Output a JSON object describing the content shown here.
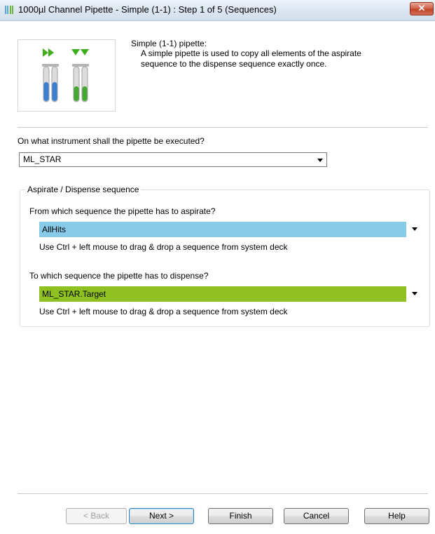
{
  "window": {
    "title": "1000µl Channel Pipette - Simple (1-1) : Step 1 of 5 (Sequences)",
    "close_label": "✕"
  },
  "description": {
    "title": "Simple (1-1) pipette:",
    "text": "A simple pipette is used to copy all elements of the aspirate sequence to the dispense sequence exactly once."
  },
  "instrument": {
    "question": "On what instrument shall the pipette be executed?",
    "selected": "ML_STAR"
  },
  "sequences": {
    "group_title": "Aspirate / Dispense sequence",
    "aspirate": {
      "question": "From which sequence the pipette has to aspirate?",
      "value": "AllHits",
      "hint": "Use Ctrl + left mouse to drag & drop a sequence from system deck",
      "color": "#87cbe8"
    },
    "dispense": {
      "question": "To which sequence the pipette has to dispense?",
      "value": "ML_STAR.Target",
      "hint": "Use Ctrl + left mouse to drag & drop a sequence from system deck",
      "color": "#8ec121"
    }
  },
  "buttons": {
    "back": "< Back",
    "next": "Next >",
    "finish": "Finish",
    "cancel": "Cancel",
    "help": "Help"
  },
  "icons": {
    "title": "pipette-app-icon",
    "illustration": "pipette-tubes-illustration",
    "close": "close-icon",
    "dropdown": "chevron-down-icon"
  }
}
